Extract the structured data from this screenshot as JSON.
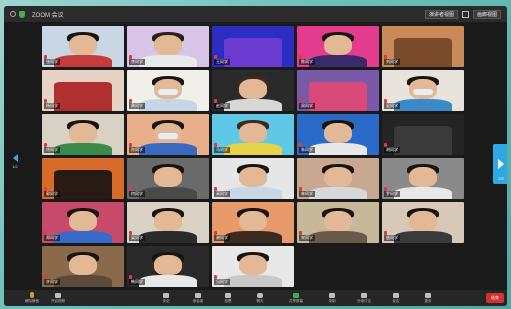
{
  "window": {
    "title": "ZOOM 会议",
    "view_button": "演讲者视图",
    "view_button_2": "画廊视图"
  },
  "gallery": {
    "page_left": "1/2",
    "page_right": "2/2",
    "tiles": [
      {
        "name": "张同学",
        "bg": "#c9d6e3",
        "body": "#c43c3c",
        "hair": "#1a1410",
        "mask": false,
        "face": true
      },
      {
        "name": "李同学",
        "bg": "#d7c4e6",
        "body": "#e9e9e9",
        "hair": "#2a1f18",
        "mask": false,
        "face": true
      },
      {
        "name": "王同学",
        "bg": "#2b2ec0",
        "body": "#6b3ad0",
        "hair": "#0f0f3a",
        "mask": false,
        "face": false
      },
      {
        "name": "陈同学",
        "bg": "#e33c8f",
        "body": "#3a2a6a",
        "hair": "#1a1410",
        "mask": false,
        "face": true
      },
      {
        "name": "刘同学",
        "bg": "#c98a5a",
        "body": "#7a4a2a",
        "hair": "#2a1a10",
        "mask": false,
        "face": false
      },
      {
        "name": "杨同学",
        "bg": "#e6d3c3",
        "body": "#b03030",
        "hair": "#1a1410",
        "mask": false,
        "face": false
      },
      {
        "name": "黄同学",
        "bg": "#f0efe9",
        "body": "#c7d6e6",
        "hair": "#1a1410",
        "mask": true,
        "face": true
      },
      {
        "name": "赵同学",
        "bg": "#2a2a2a",
        "body": "#d8d8d8",
        "hair": "#3a2a20",
        "mask": false,
        "face": true
      },
      {
        "name": "周同学",
        "bg": "#7a5aa8",
        "body": "#d84a7a",
        "hair": "#3a2040",
        "mask": false,
        "face": false
      },
      {
        "name": "吴同学",
        "bg": "#e8e4dc",
        "body": "#3a8ac8",
        "hair": "#1a1410",
        "mask": true,
        "face": true
      },
      {
        "name": "徐同学",
        "bg": "#d9d1c3",
        "body": "#3c8a4a",
        "hair": "#1a1410",
        "mask": false,
        "face": true
      },
      {
        "name": "孙同学",
        "bg": "#e8b08a",
        "body": "#3a6ac0",
        "hair": "#1a1410",
        "mask": true,
        "face": true
      },
      {
        "name": "马同学",
        "bg": "#5ec8e6",
        "body": "#e6d34a",
        "hair": "#3a2a20",
        "mask": false,
        "face": true
      },
      {
        "name": "朱同学",
        "bg": "#2a6ac8",
        "body": "#e8e8e8",
        "hair": "#1a1410",
        "mask": false,
        "face": true
      },
      {
        "name": "胡同学",
        "bg": "#242424",
        "body": "#3a3a3a",
        "hair": "#242424",
        "mask": false,
        "face": false
      },
      {
        "name": "郭同学",
        "bg": "#d86a2a",
        "body": "#2a1a14",
        "hair": "#0a0a0a",
        "mask": false,
        "face": false
      },
      {
        "name": "何同学",
        "bg": "#6a6a6a",
        "body": "#4a4a4a",
        "hair": "#1a1410",
        "mask": false,
        "face": true
      },
      {
        "name": "高同学",
        "bg": "#e6e6e6",
        "body": "#c9d6e3",
        "hair": "#1a1410",
        "mask": false,
        "face": true
      },
      {
        "name": "林同学",
        "bg": "#c8a890",
        "body": "#d8d8d8",
        "hair": "#1a1410",
        "mask": false,
        "face": true
      },
      {
        "name": "罗同学",
        "bg": "#8a8a8a",
        "body": "#e8e8e8",
        "hair": "#1a1410",
        "mask": false,
        "face": true
      },
      {
        "name": "郑同学",
        "bg": "#c84a6a",
        "body": "#3a6ac8",
        "hair": "#1a1410",
        "mask": false,
        "face": true
      },
      {
        "name": "梁同学",
        "bg": "#d9d1c3",
        "body": "#2a2a2a",
        "hair": "#1a1410",
        "mask": false,
        "face": true
      },
      {
        "name": "谢同学",
        "bg": "#e89a6a",
        "body": "#3a2a20",
        "hair": "#1a1410",
        "mask": false,
        "face": true
      },
      {
        "name": "宋同学",
        "bg": "#c8b89a",
        "body": "#6a5a4a",
        "hair": "#1a1410",
        "mask": false,
        "face": true
      },
      {
        "name": "唐同学",
        "bg": "#d8c8b8",
        "body": "#3a3a3a",
        "hair": "#1a1410",
        "mask": false,
        "face": true
      },
      {
        "name": "许同学",
        "bg": "#8a6a4a",
        "body": "#5a4a3a",
        "hair": "#1a1410",
        "mask": false,
        "face": true
      },
      {
        "name": "韩同学",
        "bg": "#2a2a2a",
        "body": "#e8e8e8",
        "hair": "#1a1410",
        "mask": false,
        "face": true
      },
      {
        "name": "冯同学",
        "bg": "#e8e8e8",
        "body": "#c8c8c8",
        "hair": "#1a1410",
        "mask": false,
        "face": true
      }
    ]
  },
  "toolbar": {
    "items": [
      {
        "label": "解除静音",
        "kind": "mic"
      },
      {
        "label": "开启视频",
        "kind": "video"
      },
      {
        "label": "安全",
        "kind": "security"
      },
      {
        "label": "参会者",
        "kind": "participants"
      },
      {
        "label": "投票",
        "kind": "poll"
      },
      {
        "label": "聊天",
        "kind": "chat"
      },
      {
        "label": "共享屏幕",
        "kind": "share"
      },
      {
        "label": "录制",
        "kind": "record"
      },
      {
        "label": "分组讨论",
        "kind": "breakout"
      },
      {
        "label": "反应",
        "kind": "reactions"
      },
      {
        "label": "更多",
        "kind": "more"
      }
    ],
    "end_label": "结束"
  }
}
